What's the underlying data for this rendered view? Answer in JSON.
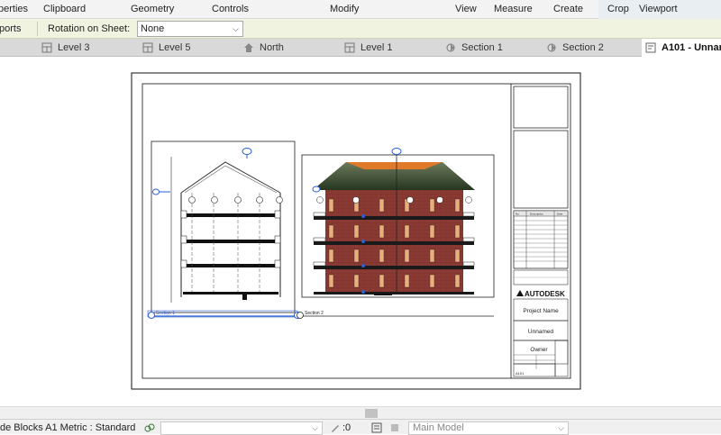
{
  "ribbon": {
    "groups": [
      "Properties",
      "Clipboard",
      "Geometry",
      "Controls",
      "Modify",
      "View",
      "Measure",
      "Create",
      "Crop",
      "Viewport"
    ],
    "first_partial": "perties"
  },
  "options_bar": {
    "left_partial": "ports",
    "rotation_label": "Rotation on Sheet:",
    "rotation_value": "None"
  },
  "tabs": [
    {
      "label": "Level 3",
      "icon": "floor-plan-icon"
    },
    {
      "label": "Level 5",
      "icon": "floor-plan-icon"
    },
    {
      "label": "North",
      "icon": "elevation-icon"
    },
    {
      "label": "Level 1",
      "icon": "floor-plan-icon"
    },
    {
      "label": "Section 1",
      "icon": "section-icon"
    },
    {
      "label": "Section 2",
      "icon": "section-icon"
    },
    {
      "label": "A101 - Unnar",
      "icon": "sheet-icon",
      "active": true
    }
  ],
  "sheet": {
    "section1_label": "Section 1",
    "section2_label": "Section 2",
    "title_block": {
      "brand": "AUTODESK",
      "project_name": "Project Name",
      "sheet_name": "Unnamed",
      "owner": "Owner",
      "sheet_number": "A101",
      "rev_headers": [
        "No.",
        "Description",
        "Date"
      ]
    }
  },
  "status": {
    "text": "de Blocks A1 Metric : Standard",
    "workset_placeholder": "",
    "counter": ":0",
    "model": "Main Model"
  },
  "colors": {
    "brick": "#8a3a33",
    "roof": "#e07a2b",
    "foliage": "#3a5a3a",
    "selection_blue": "#2b5fd6"
  }
}
